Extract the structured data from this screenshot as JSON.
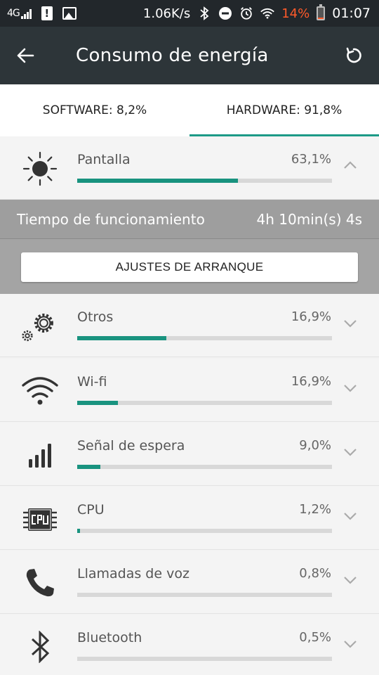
{
  "status_bar": {
    "network": "4G",
    "notification": "!",
    "speed": "1.06K/s",
    "battery": "14%",
    "time": "01:07"
  },
  "app_bar": {
    "title": "Consumo de energía"
  },
  "tabs": [
    {
      "label": "SOFTWARE: 8,2%",
      "active": false
    },
    {
      "label": "HARDWARE: 91,8%",
      "active": true
    }
  ],
  "expanded": {
    "uptime_label": "Tiempo de funcionamiento",
    "uptime_value": "4h 10min(s) 4s",
    "startup_button": "AJUSTES DE ARRANQUE"
  },
  "items": [
    {
      "label": "Pantalla",
      "percent": "63,1%",
      "fraction": 0.631,
      "icon": "sun-icon",
      "expanded": true
    },
    {
      "label": "Otros",
      "percent": "16,9%",
      "fraction": 0.35,
      "icon": "gears-icon",
      "expanded": false
    },
    {
      "label": "Wi-fi",
      "percent": "16,9%",
      "fraction": 0.16,
      "icon": "wifi-icon",
      "expanded": false
    },
    {
      "label": "Señal de espera",
      "percent": "9,0%",
      "fraction": 0.09,
      "icon": "signal-icon",
      "expanded": false
    },
    {
      "label": "CPU",
      "percent": "1,2%",
      "fraction": 0.012,
      "icon": "cpu-icon",
      "expanded": false
    },
    {
      "label": "Llamadas de voz",
      "percent": "0,8%",
      "fraction": 0.0,
      "icon": "phone-icon",
      "expanded": false
    },
    {
      "label": "Bluetooth",
      "percent": "0,5%",
      "fraction": 0.0,
      "icon": "bluetooth-icon",
      "expanded": false
    }
  ],
  "colors": {
    "accent": "#19937f",
    "app_bar": "#2d3539",
    "status_bar": "#22272b",
    "battery_low": "#ff5a2a"
  }
}
